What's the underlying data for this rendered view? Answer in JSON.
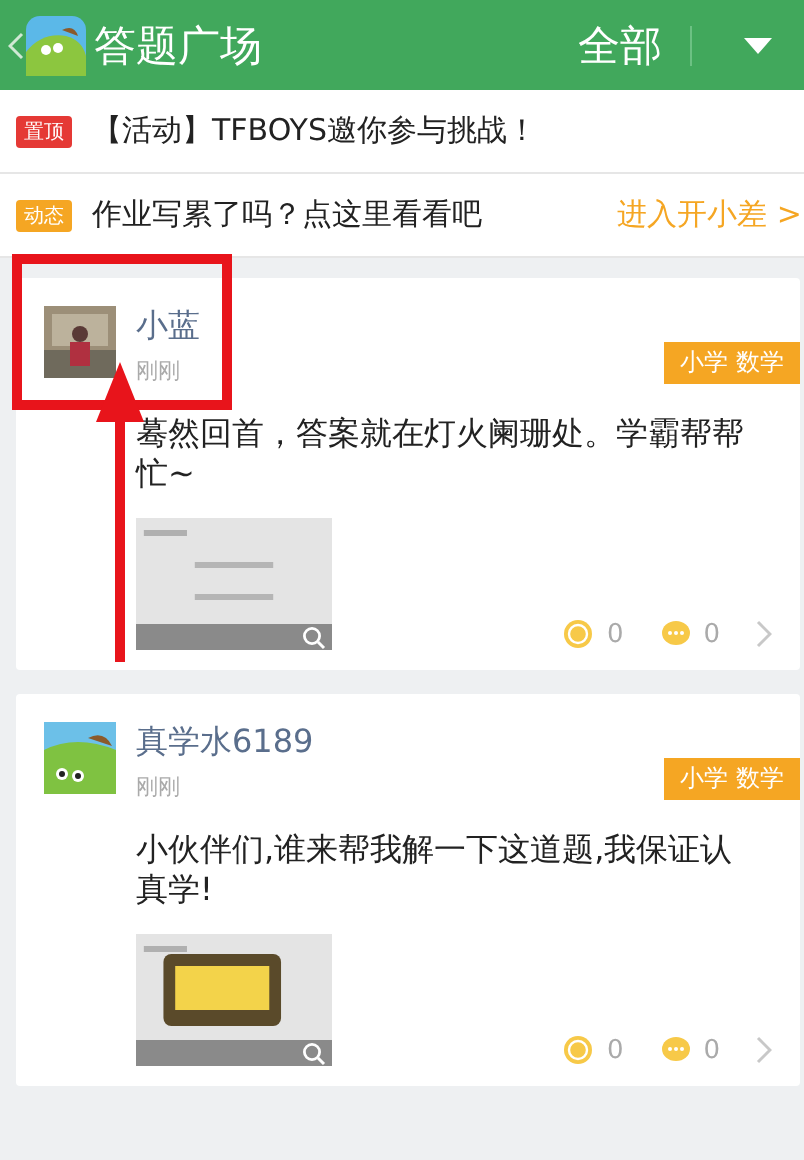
{
  "header": {
    "title": "答题广场",
    "filter": "全部"
  },
  "notices": [
    {
      "kind": "pinned",
      "badge": "置顶",
      "text": "【活动】TFBOYS邀你参与挑战！"
    },
    {
      "kind": "dynamic",
      "badge": "动态",
      "text": "作业写累了吗？点这里看看吧",
      "link": "进入开小差 >"
    }
  ],
  "posts": [
    {
      "user": "小蓝",
      "time": "刚刚",
      "tag": "小学 数学",
      "text": "蓦然回首，答案就在灯火阑珊处。学霸帮帮忙~",
      "reward": "0",
      "comments": "0"
    },
    {
      "user": "真学水6189",
      "time": "刚刚",
      "tag": "小学 数学",
      "text": "小伙伴们,谁来帮我解一下这道题,我保证认真学!",
      "reward": "0",
      "comments": "0"
    }
  ]
}
